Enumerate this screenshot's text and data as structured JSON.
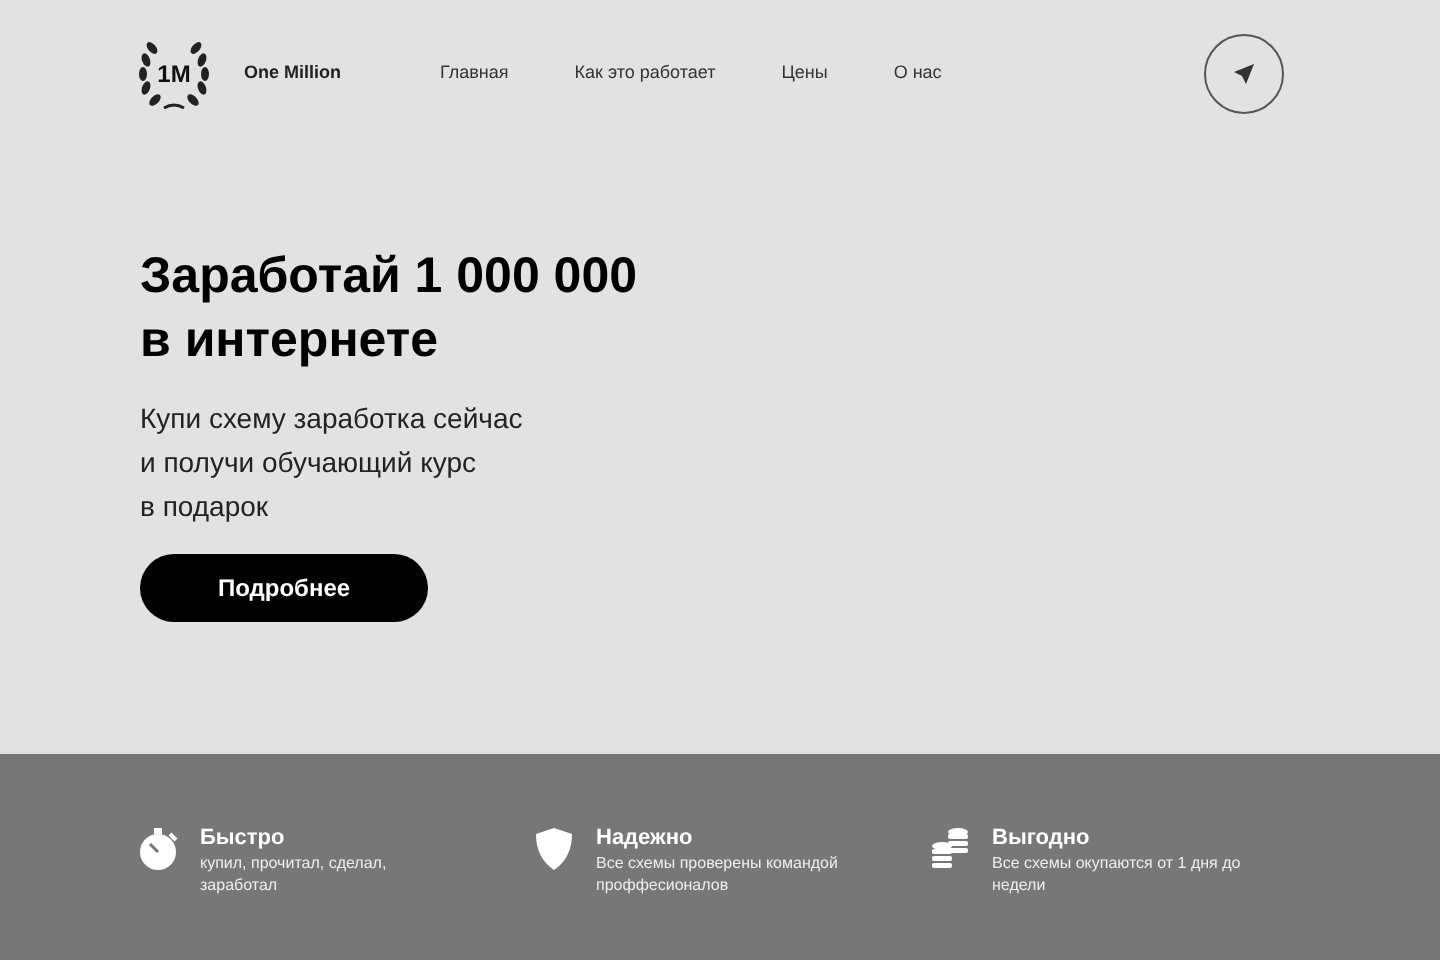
{
  "logo": {
    "mark": "1M",
    "name": "One Million"
  },
  "nav": [
    "Главная",
    "Как это работает",
    "Цены",
    "О нас"
  ],
  "hero": {
    "title_lines": [
      "Заработай 1 000 000",
      "в интернете"
    ],
    "subtitle_lines": [
      "Купи схему заработка сейчас",
      "и получи обучающий курс",
      "в подарок"
    ],
    "button": "Подробнее"
  },
  "features": [
    {
      "kind": "stopwatch",
      "title": "Быстро",
      "text": "купил, прочитал, сделал, заработал"
    },
    {
      "kind": "shield",
      "title": "Надежно",
      "text": "Все схемы проверены командой проффесионалов"
    },
    {
      "kind": "coins",
      "title": "Выгодно",
      "text": "Все схемы окупаются от 1 дня до недели"
    }
  ]
}
